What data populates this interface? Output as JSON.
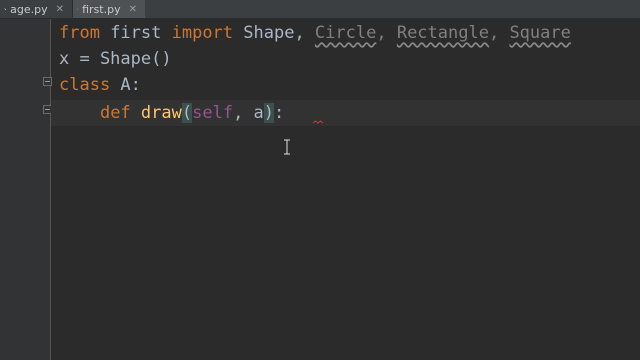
{
  "tabs": [
    {
      "label": "age.py",
      "active": false
    },
    {
      "label": "first.py",
      "active": true
    }
  ],
  "code": {
    "line1": {
      "kw_from": "from",
      "module": " first ",
      "kw_import": "import",
      "name1": " Shape, ",
      "name2": "Circle",
      "sep2": ", ",
      "name3": "Rectangle",
      "sep3": ", ",
      "name4": "Square"
    },
    "line2": {
      "text": "x = Shape()"
    },
    "line3": {
      "kw_class": "class",
      "rest": " A:"
    },
    "line4": {
      "indent": "    ",
      "kw_def": "def",
      "fname": " draw",
      "lparen": "(",
      "self": "self",
      "comma": ", ",
      "param": "a",
      "rparen": ")",
      "colon": ":"
    }
  },
  "colors": {
    "background": "#2b2b2b",
    "keyword": "#cc7832",
    "text": "#a9b7c6",
    "self": "#94558d",
    "gutter": "#313335",
    "tabbar": "#3c3f41",
    "bulb": "#f0c24b"
  },
  "icons": {
    "tab_icon": "python-file-icon",
    "intention": "lightbulb-icon",
    "fold": "fold-marker-icon",
    "cursor": "text-cursor-icon"
  }
}
